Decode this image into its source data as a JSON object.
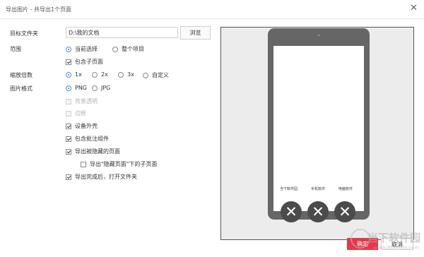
{
  "dialog": {
    "title": "导出图片 - 共导出1个页面"
  },
  "fields": {
    "target_folder_label": "目标文件夹",
    "target_folder_value": "D:\\我的文档",
    "browse_label": "浏览",
    "range_label": "范围",
    "range_options": [
      "当前选择",
      "整个项目"
    ],
    "include_subpages_label": "包含子页面",
    "scale_label": "缩放倍数",
    "scale_options": [
      "1x",
      "2x",
      "3x",
      "自定义"
    ],
    "format_label": "图片格式",
    "format_options": [
      "PNG",
      "JPG"
    ],
    "bg_transparent_label": "背景透明",
    "border_label": "边框",
    "device_shell_label": "设备外壳",
    "include_annotations_label": "包含批注组件",
    "export_hidden_label": "导出被隐藏的页面",
    "export_hidden_sub_label": "导出\"隐藏页面\"下的子页面",
    "open_folder_label": "导出完成后，打开文件夹"
  },
  "preview": {
    "apps": [
      "当下软件园",
      "手机软件",
      "电脑软件"
    ],
    "app_icon": "close-x-icon"
  },
  "footer": {
    "confirm_label": "确定",
    "cancel_label": "取消"
  },
  "watermark": {
    "text": "当下软件园",
    "url": "www.downxia.com"
  },
  "colors": {
    "accent": "#e8374a",
    "radio": "#3a7fd0",
    "phone": "#666666"
  }
}
